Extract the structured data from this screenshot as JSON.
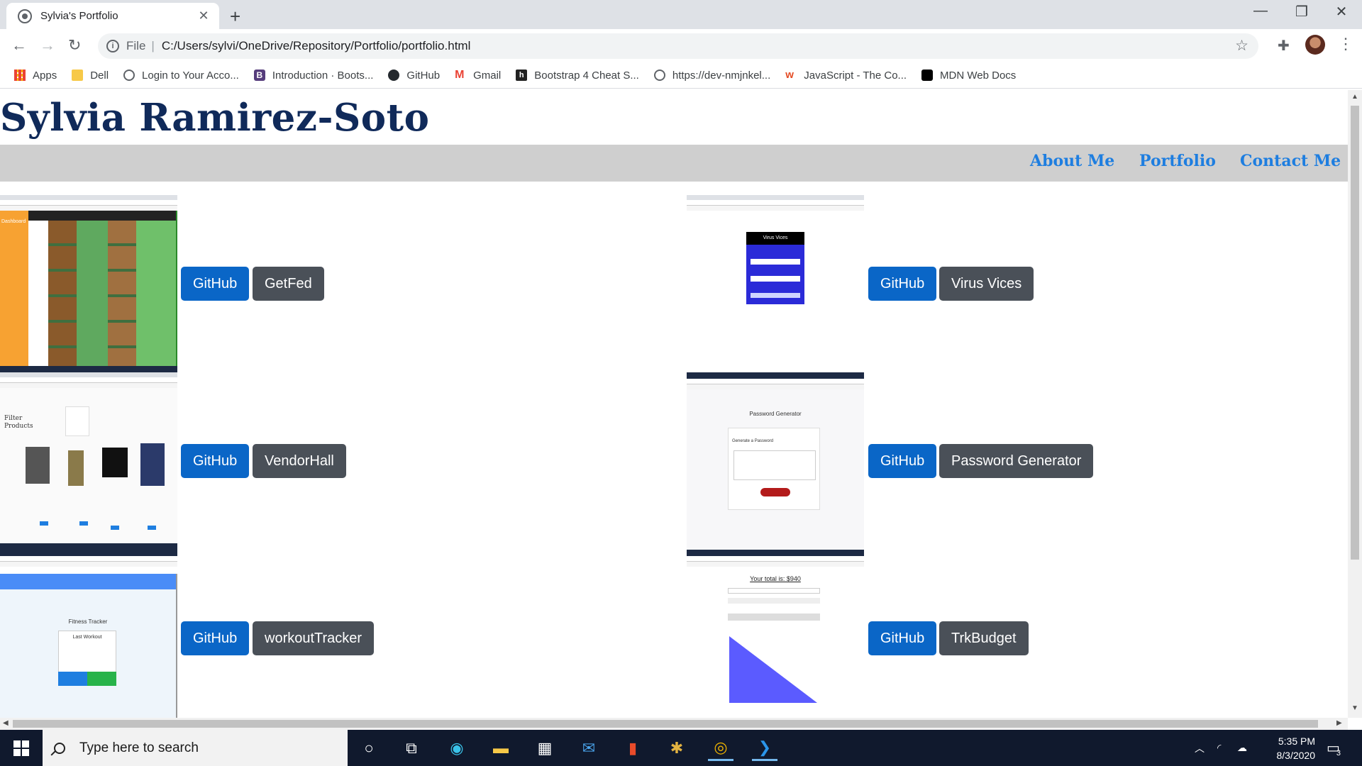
{
  "browser": {
    "tab_title": "Sylvia's Portfolio",
    "new_tab": "+",
    "scheme_label": "File",
    "url": "C:/Users/sylvi/OneDrive/Repository/Portfolio/portfolio.html"
  },
  "bookmarks": [
    {
      "label": "Apps",
      "icon": "apps-grid-icon"
    },
    {
      "label": "Dell",
      "icon": "folder-icon"
    },
    {
      "label": "Login to Your Acco...",
      "icon": "globe-icon"
    },
    {
      "label": "Introduction · Boots...",
      "icon": "bootstrap-icon"
    },
    {
      "label": "GitHub",
      "icon": "github-icon"
    },
    {
      "label": "Gmail",
      "icon": "gmail-icon"
    },
    {
      "label": "Bootstrap 4 Cheat S...",
      "icon": "hackerthemes-icon"
    },
    {
      "label": "https://dev-nmjnkel...",
      "icon": "globe-icon"
    },
    {
      "label": "JavaScript - The Co...",
      "icon": "w3-icon"
    },
    {
      "label": "MDN Web Docs",
      "icon": "mdn-icon"
    }
  ],
  "page": {
    "title": "Sylvia Ramirez-Soto",
    "nav": [
      "About Me",
      "Portfolio",
      "Contact Me"
    ]
  },
  "projects": [
    {
      "github_label": "GitHub",
      "name": "GetFed"
    },
    {
      "github_label": "GitHub",
      "name": "Virus Vices"
    },
    {
      "github_label": "GitHub",
      "name": "VendorHall"
    },
    {
      "github_label": "GitHub",
      "name": "Password Generator"
    },
    {
      "github_label": "GitHub",
      "name": "workoutTracker"
    },
    {
      "github_label": "GitHub",
      "name": "TrkBudget"
    }
  ],
  "thumbnails": {
    "getfed_brand": "Dashboard",
    "virus_title": "Virus Vices",
    "vendor_filter": "Filter Products",
    "password_title": "Password Generator",
    "password_card": "Generate a Password",
    "workout_title": "Fitness Tracker",
    "workout_card": "Last Workout",
    "budget_total": "Your total is: $940"
  },
  "taskbar": {
    "search_placeholder": "Type here to search",
    "time": "5:35 PM",
    "date": "8/3/2020",
    "notifications": "3"
  },
  "colors": {
    "title": "#102a5a",
    "nav_link": "#1e7ee0",
    "navbar_bg": "#cfcfcf",
    "github_btn": "#0a66c7",
    "project_btn": "#4a5058"
  }
}
